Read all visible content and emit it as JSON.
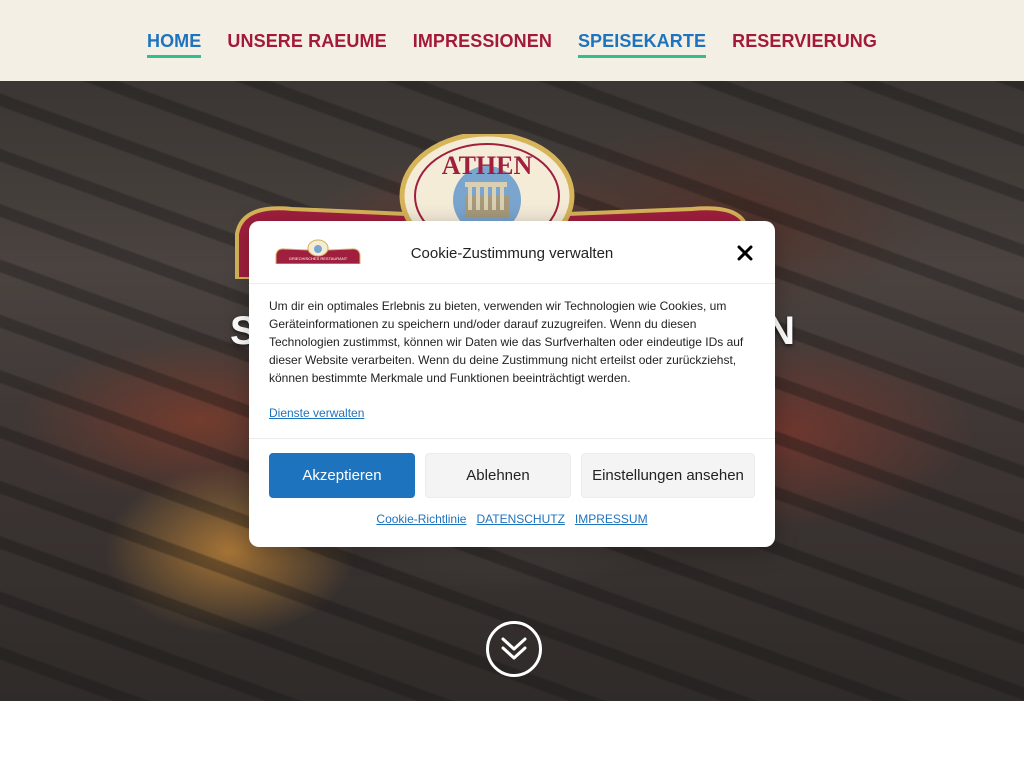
{
  "nav": {
    "items": [
      {
        "label": "HOME",
        "active": true
      },
      {
        "label": "UNSERE RAEUME",
        "active": false
      },
      {
        "label": "IMPRESSIONEN",
        "active": false
      },
      {
        "label": "SPEISEKARTE",
        "active": true
      },
      {
        "label": "RESERVIERUNG",
        "active": false
      }
    ]
  },
  "hero": {
    "logo_text": "ATHEN",
    "heading_left": "S",
    "heading_right": "N"
  },
  "cookie": {
    "logo_text": "GRIECHISCHES RESTAURANT",
    "title": "Cookie-Zustimmung verwalten",
    "body": "Um dir ein optimales Erlebnis zu bieten, verwenden wir Technologien wie Cookies, um Geräteinformationen zu speichern und/oder darauf zuzugreifen. Wenn du diesen Technologien zustimmst, können wir Daten wie das Surfverhalten oder eindeutige IDs auf dieser Website verarbeiten. Wenn du deine Zustimmung nicht erteilst oder zurückziehst, können bestimmte Merkmale und Funktionen beeinträchtigt werden.",
    "manage_link": "Dienste verwalten",
    "accept_label": "Akzeptieren",
    "deny_label": "Ablehnen",
    "prefs_label": "Einstellungen ansehen",
    "links": [
      "Cookie-Richtlinie",
      "DATENSCHUTZ",
      "IMPRESSUM"
    ]
  },
  "colors": {
    "nav_bg": "#f3efe4",
    "nav_text": "#a3193a",
    "nav_active": "#1e73be",
    "nav_underline": "#2ebf91",
    "accent": "#1e73be"
  },
  "icons": {
    "close": "close-icon",
    "scroll": "chevron-double-down-icon"
  }
}
